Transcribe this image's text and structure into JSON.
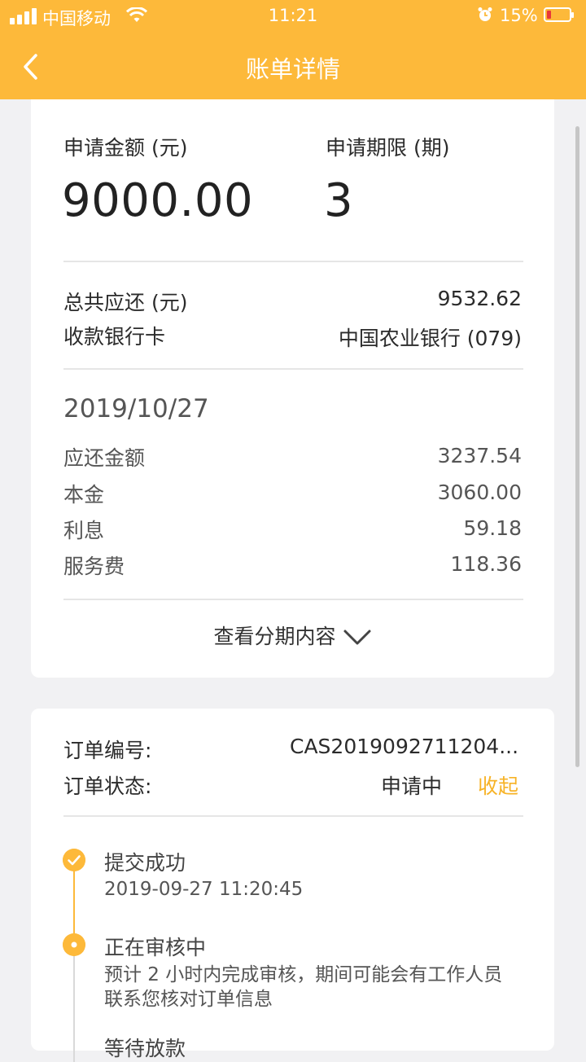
{
  "status_bar": {
    "carrier": "中国移动",
    "time": "11:21",
    "battery_percent": "15%",
    "battery_level": 0.15,
    "battery_color": "#e8373a"
  },
  "header": {
    "title": "账单详情",
    "back_icon": "chevron-left-icon",
    "background_color": "#fdb93a"
  },
  "summary": {
    "amount_label": "申请金额 (元)",
    "amount_value": "9000.00",
    "term_label": "申请期限 (期)",
    "term_value": "3",
    "total_label": "总共应还 (元)",
    "total_value": "9532.62",
    "bank_label": "收款银行卡",
    "bank_value": "中国农业银行 (079)"
  },
  "installment": {
    "date": "2019/10/27",
    "rows": [
      {
        "label": "应还金额",
        "value": "3237.54"
      },
      {
        "label": "本金",
        "value": "3060.00"
      },
      {
        "label": "利息",
        "value": "59.18"
      },
      {
        "label": "服务费",
        "value": "118.36"
      }
    ],
    "expand_label": "查看分期内容",
    "expand_icon": "chevron-down-icon"
  },
  "order": {
    "number_label": "订单编号:",
    "number_value": "CAS2019092711204...",
    "status_label": "订单状态:",
    "status_value": "申请中",
    "collapse_label": "收起",
    "accent_color": "#f7b327"
  },
  "timeline": [
    {
      "title": "提交成功",
      "detail": "2019-09-27 11:20:45",
      "icon": "check-icon"
    },
    {
      "title": "正在审核中",
      "detail": "预计 2 小时内完成审核，期间可能会有工作人员",
      "detail2": "联系您核对订单信息",
      "icon": "dot-icon"
    },
    {
      "title": "等待放款"
    }
  ]
}
